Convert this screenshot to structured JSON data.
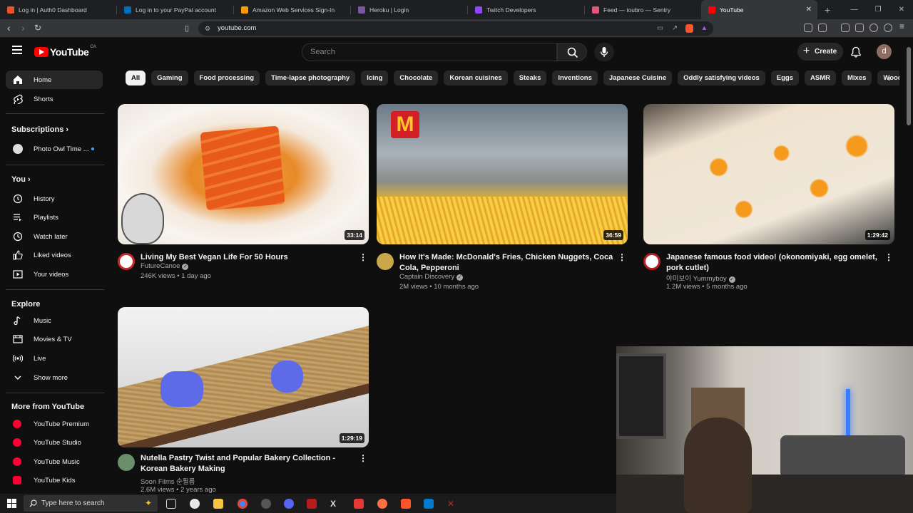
{
  "browser": {
    "tabs": [
      {
        "title": "Log in | Auth0 Dashboard",
        "color": "#eb5424"
      },
      {
        "title": "Log in to your PayPal account",
        "color": "#0070ba"
      },
      {
        "title": "Amazon Web Services Sign-In",
        "color": "#ff9900"
      },
      {
        "title": "Heroku | Login",
        "color": "#79589f"
      },
      {
        "title": "Twitch Developers",
        "color": "#9146ff"
      },
      {
        "title": "Feed — ioubro — Sentry",
        "color": "#e1567c"
      },
      {
        "title": "YouTube",
        "color": "#ff0000"
      }
    ],
    "url": "youtube.com"
  },
  "header": {
    "region": "CA",
    "search_placeholder": "Search",
    "create_label": "Create",
    "avatar_letter": "d"
  },
  "sidebar": {
    "main": [
      {
        "label": "Home",
        "icon": "home-icon"
      },
      {
        "label": "Shorts",
        "icon": "shorts-icon"
      }
    ],
    "subscriptions_title": "Subscriptions",
    "subscriptions": [
      {
        "label": "Photo Owl Time ..."
      }
    ],
    "you_title": "You",
    "you": [
      {
        "label": "History",
        "icon": "history-icon"
      },
      {
        "label": "Playlists",
        "icon": "playlists-icon"
      },
      {
        "label": "Watch later",
        "icon": "watch-later-icon"
      },
      {
        "label": "Liked videos",
        "icon": "liked-icon"
      },
      {
        "label": "Your videos",
        "icon": "your-videos-icon"
      }
    ],
    "explore_title": "Explore",
    "explore": [
      {
        "label": "Music",
        "icon": "music-icon"
      },
      {
        "label": "Movies & TV",
        "icon": "movies-icon"
      },
      {
        "label": "Live",
        "icon": "live-icon"
      },
      {
        "label": "Show more",
        "icon": "chevron-down-icon"
      }
    ],
    "more_title": "More from YouTube",
    "more": [
      {
        "label": "YouTube Premium"
      },
      {
        "label": "YouTube Studio"
      },
      {
        "label": "YouTube Music"
      },
      {
        "label": "YouTube Kids"
      }
    ]
  },
  "chips": [
    "All",
    "Gaming",
    "Food processing",
    "Time-lapse photography",
    "Icing",
    "Chocolate",
    "Korean cuisines",
    "Steaks",
    "Inventions",
    "Japanese Cuisine",
    "Oddly satisfying videos",
    "Eggs",
    "ASMR",
    "Mixes",
    "Wood Carving"
  ],
  "videos": [
    {
      "title": "Living My Best Vegan Life For 50 Hours",
      "channel": "FutureCanoe",
      "views": "246K views",
      "age": "1 day ago",
      "duration": "33:14"
    },
    {
      "title": "How It's Made: McDonald's Fries, Chicken Nuggets, Coca Cola, Pepperoni",
      "channel": "Captain Discovery",
      "views": "2M views",
      "age": "10 months ago",
      "duration": "36:59",
      "brand": "M"
    },
    {
      "title": "Japanese famous food video! (okonomiyaki, egg omelet, pork cutlet)",
      "channel": "야미보이 Yummyboy",
      "views": "1.2M views",
      "age": "5 months ago",
      "duration": "1:29:42"
    },
    {
      "title": "Nutella Pastry Twist and Popular Bakery Collection - Korean Bakery Making",
      "channel": "Soon Films 순필름",
      "views": "2.6M views",
      "age": "2 years ago",
      "duration": "1:29:19"
    }
  ],
  "taskbar": {
    "search_placeholder": "Type here to search"
  }
}
